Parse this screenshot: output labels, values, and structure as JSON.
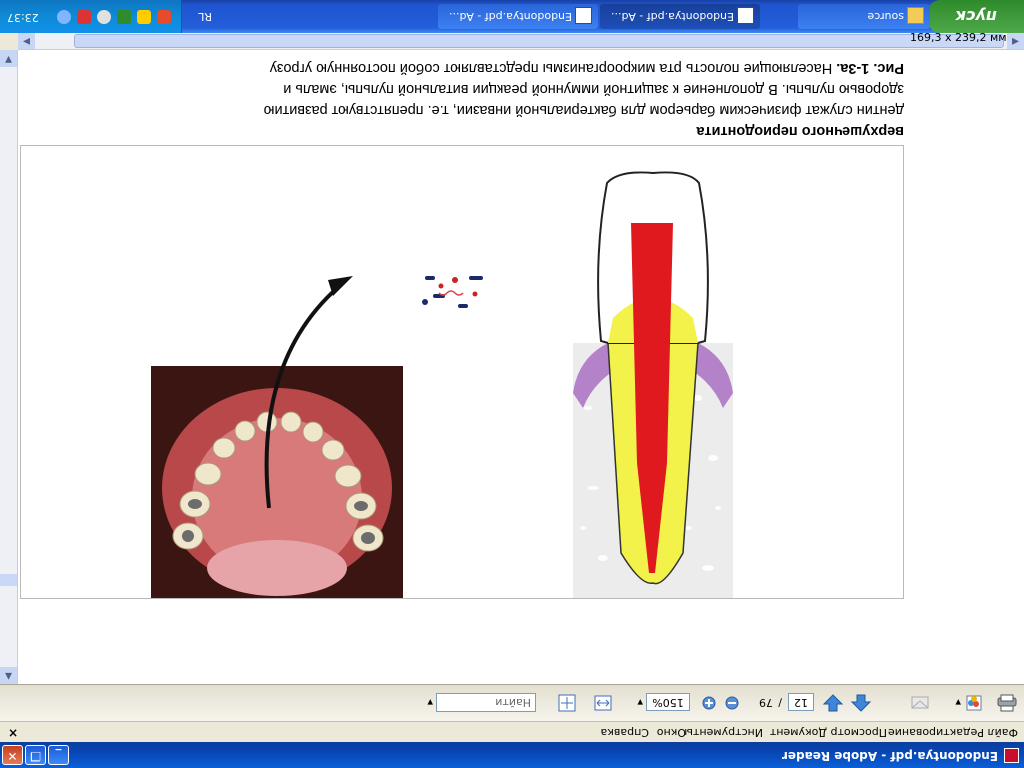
{
  "window": {
    "title": "Endodontya.pdf - Adobe Reader",
    "controls": {
      "minimize": "_",
      "maximize": "❐",
      "close": "✕"
    }
  },
  "menu": {
    "items": [
      "Файл",
      "Редактирование",
      "Просмотр",
      "Документ",
      "Инструменты",
      "Окно",
      "Справка"
    ],
    "close_doc": "×"
  },
  "toolbar": {
    "page_current": "12",
    "page_separator": "/",
    "page_total": "79",
    "zoom": "150%",
    "search_placeholder": "Найти"
  },
  "status": {
    "page_size": "169,3 x 239,2 мм"
  },
  "document": {
    "caption": {
      "label": "Рис. 1-3а.",
      "line1": " Населяющие полость рта микроорганизмы представляют собой постоянную угрозу",
      "line2": "здоровью пульпы. В дополнение к защитной иммунной реакции витальной пульпы, эмаль и",
      "line3": "дентин служат физическим барьером для бактериальной инвазии, т.е. препятствуют развитию",
      "line4": "верхушечного периодонтита"
    }
  },
  "taskbar": {
    "start_label": "пуск",
    "tasks": [
      {
        "label": "source",
        "icon": "folder-icon"
      },
      {
        "label": "Endodontya.pdf - Ad...",
        "icon": "pdf-icon"
      },
      {
        "label": "Endodontya.pdf - Ad...",
        "icon": "pdf-icon"
      }
    ],
    "language": "RL",
    "clock": "23:37"
  },
  "colors": {
    "titlebar": "#0a52c9",
    "taskbar": "#245edb",
    "start": "#3c9a37",
    "enamel_white": "#ffffff",
    "dentin_yellow": "#f2f24a",
    "pulp_red": "#e0191f",
    "gum_purple": "#b382c9",
    "bone_gray": "#eceaea"
  }
}
